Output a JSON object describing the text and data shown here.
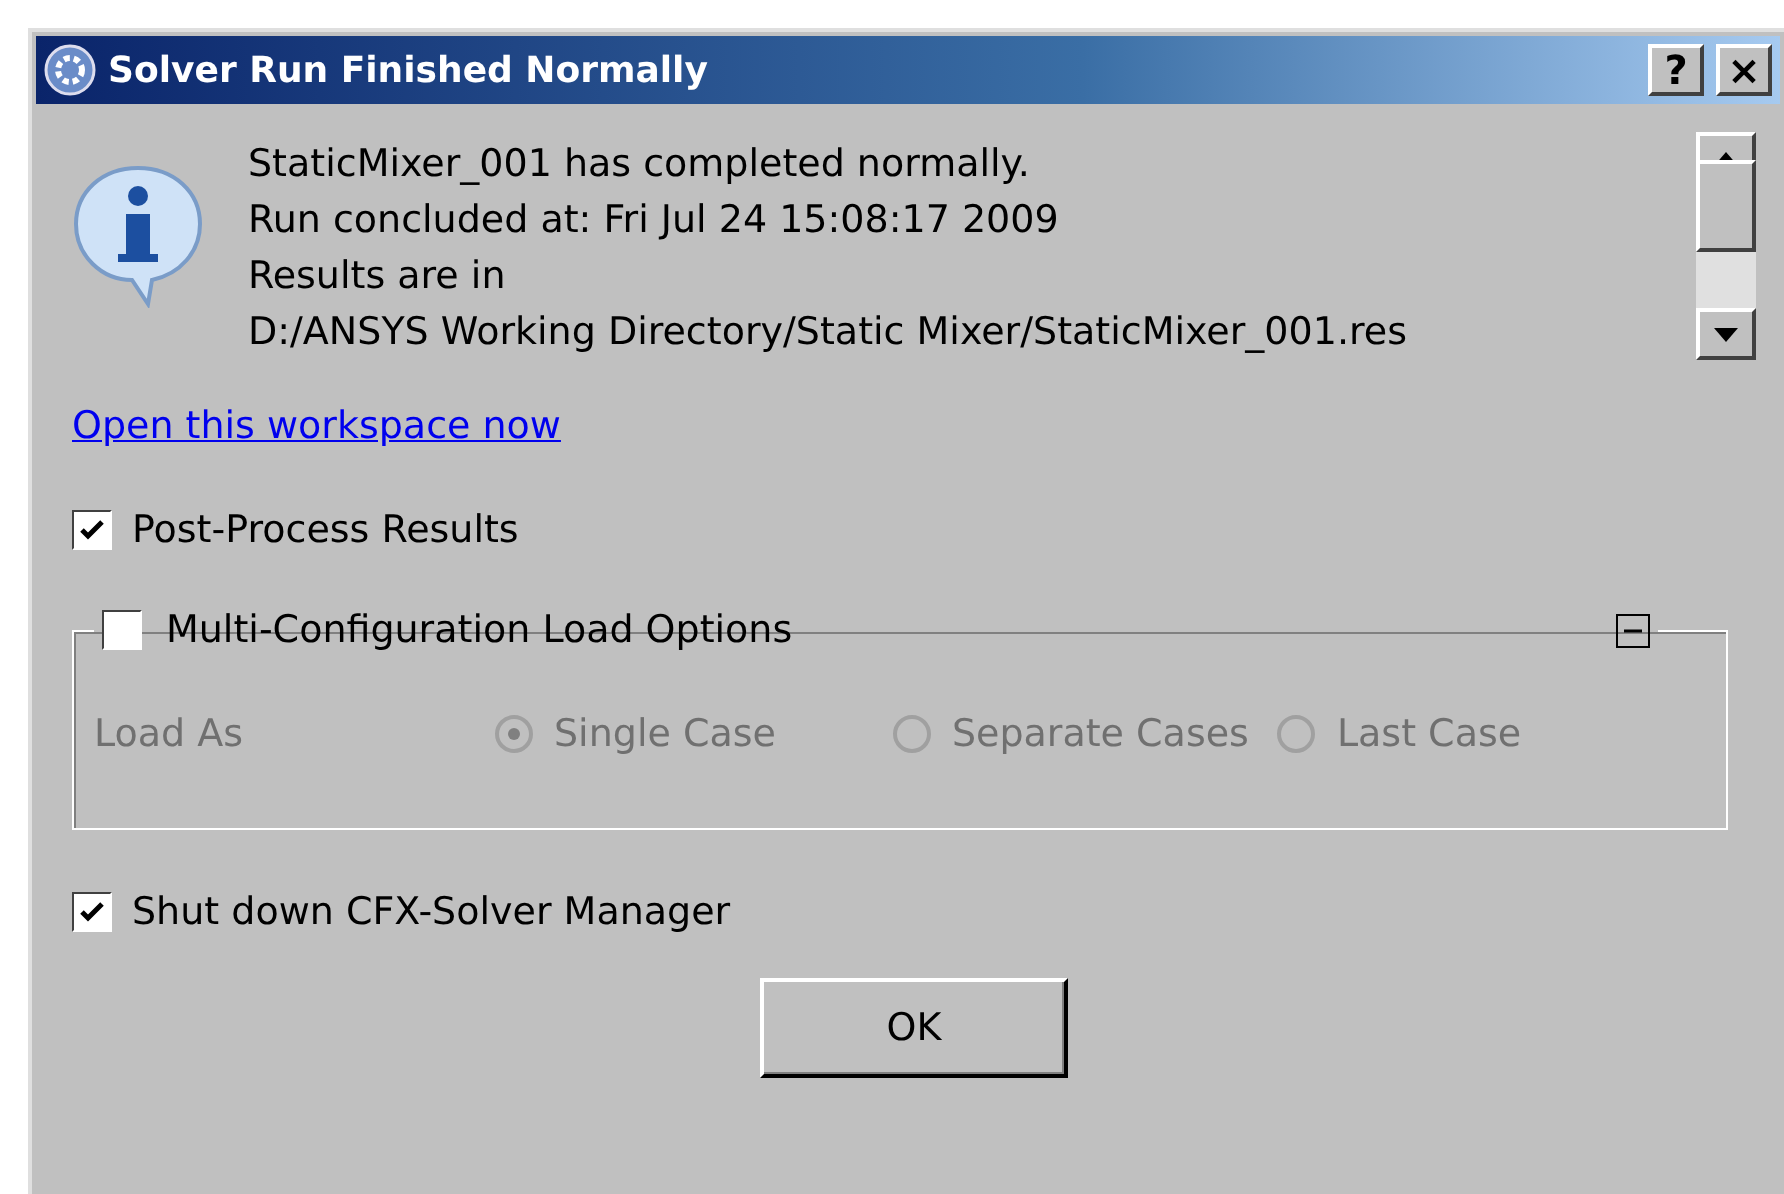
{
  "window": {
    "title": "Solver Run Finished Normally",
    "title_buttons": [
      "?",
      "×"
    ]
  },
  "message": {
    "lines": [
      "StaticMixer_001 has completed normally.",
      "Run concluded at: Fri Jul 24 15:08:17 2009",
      "Results are in",
      "D:/ANSYS Working Directory/Static Mixer/StaticMixer_001.res"
    ]
  },
  "link": "Open this workspace now",
  "post_process": {
    "label": "Post-Process Results",
    "checked": true
  },
  "multi_config": {
    "label": "Multi-Configuration Load Options",
    "checked": false,
    "expanded": true,
    "load_as": {
      "label": "Load As",
      "disabled": true,
      "options": [
        {
          "label": "Single Case",
          "selected": true
        },
        {
          "label": "Separate Cases",
          "selected": false
        },
        {
          "label": "Last Case",
          "selected": false
        }
      ]
    }
  },
  "shutdown": {
    "label": "Shut down CFX-Solver Manager",
    "checked": true
  },
  "buttons": [
    "OK"
  ]
}
